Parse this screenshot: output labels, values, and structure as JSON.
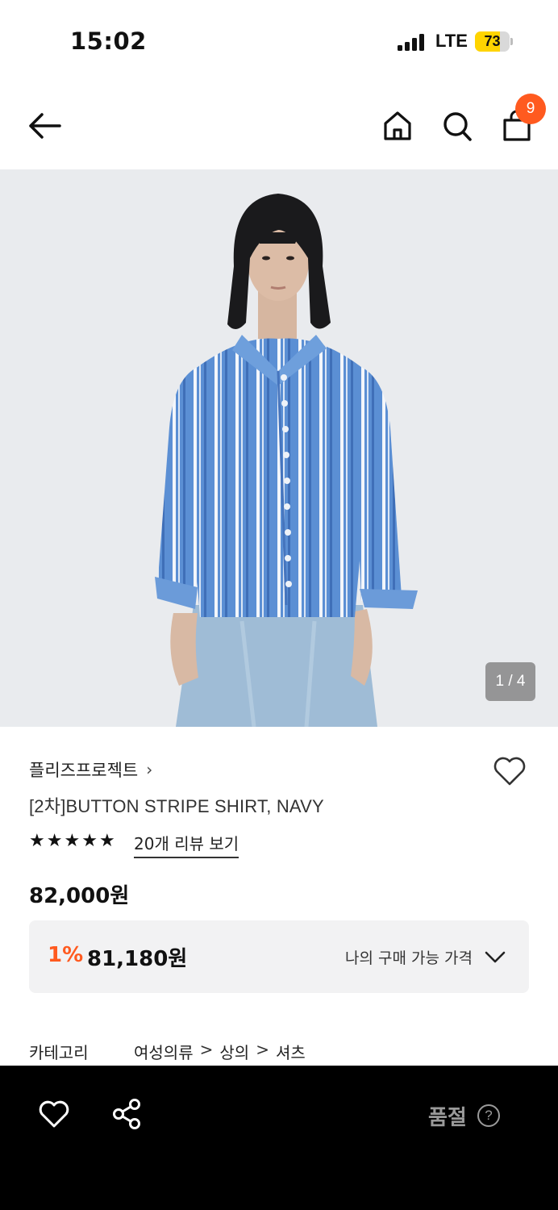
{
  "status_bar": {
    "time": "15:02",
    "network": "LTE",
    "battery": "73",
    "battery_level": 0.73,
    "signal_bars": 4
  },
  "nav": {
    "back_icon": "arrow-left-icon",
    "home_icon": "home-icon",
    "search_icon": "search-icon",
    "bag_icon": "shopping-bag-icon",
    "cart_count": "9"
  },
  "gallery": {
    "counter": "1 / 4"
  },
  "product": {
    "brand": "플리즈프로젝트",
    "brand_chevron": "›",
    "name": "[2차]BUTTON STRIPE SHIRT, NAVY",
    "rating_stars": 5,
    "review_link": "20개 리뷰 보기",
    "price": "82,000원"
  },
  "discount": {
    "rate": "1%",
    "price": "81,180원",
    "label": "나의 구매 가능 가격"
  },
  "category": {
    "label": "카테고리",
    "path": [
      "여성의류",
      "상의",
      "셔츠"
    ],
    "separator": ">"
  },
  "bottom_bar": {
    "status": "품절",
    "help": "?"
  },
  "colors": {
    "accent": "#ff5a1f",
    "battery": "#ffd400"
  }
}
